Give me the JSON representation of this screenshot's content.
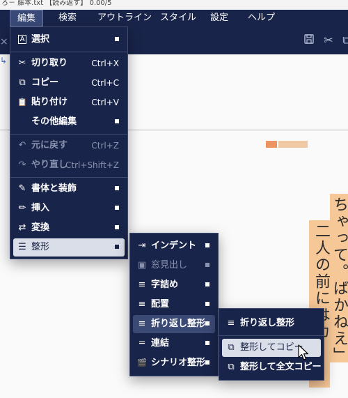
{
  "titlebar": {
    "text": "ろ－ 藤本.txt 【読み返す】 0.00/5"
  },
  "menubar": {
    "items": [
      "編集",
      "検索",
      "アウトライン",
      "スタイル",
      "設定",
      "ヘルプ"
    ]
  },
  "toolbar": {
    "icons": [
      "save-icon",
      "scissors-icon",
      "copy-icon"
    ]
  },
  "document": {
    "columns": [
      "ちゃって。ばかねえ」",
      "二人の前にはカ"
    ]
  },
  "edit_menu": {
    "items": [
      {
        "label": "選択",
        "shortcut": "",
        "icon": "A"
      },
      {
        "label": "切り取り",
        "shortcut": "Ctrl+X",
        "icon": "✂"
      },
      {
        "label": "コピー",
        "shortcut": "Ctrl+C",
        "icon": "⧉"
      },
      {
        "label": "貼り付け",
        "shortcut": "Ctrl+V",
        "icon": "📋"
      },
      {
        "label": "その他編集",
        "shortcut": "",
        "icon": ""
      },
      {
        "label": "元に戻す",
        "shortcut": "Ctrl+Z",
        "icon": "↶"
      },
      {
        "label": "やり直し",
        "shortcut": "Ctrl+Shift+Z",
        "icon": "↷"
      },
      {
        "label": "書体と装飾",
        "shortcut": "",
        "icon": "✎"
      },
      {
        "label": "挿入",
        "shortcut": "",
        "icon": "✏"
      },
      {
        "label": "変換",
        "shortcut": "",
        "icon": "⇄"
      },
      {
        "label": "整形",
        "shortcut": "",
        "icon": "☰"
      }
    ]
  },
  "format_menu": {
    "items": [
      {
        "label": "インデント",
        "icon": "⇥"
      },
      {
        "label": "窓見出し",
        "icon": "▣"
      },
      {
        "label": "字詰め",
        "icon": "≡"
      },
      {
        "label": "配置",
        "icon": "≡"
      },
      {
        "label": "折り返し整形",
        "icon": "≡"
      },
      {
        "label": "連結",
        "icon": "═"
      },
      {
        "label": "シナリオ整形",
        "icon": "🎬"
      }
    ]
  },
  "wrap_menu": {
    "items": [
      {
        "label": "折り返し整形",
        "icon": "≡"
      },
      {
        "label": "整形してコピー",
        "icon": "⧉"
      },
      {
        "label": "整形して全文コピー",
        "icon": "⧉"
      }
    ]
  }
}
